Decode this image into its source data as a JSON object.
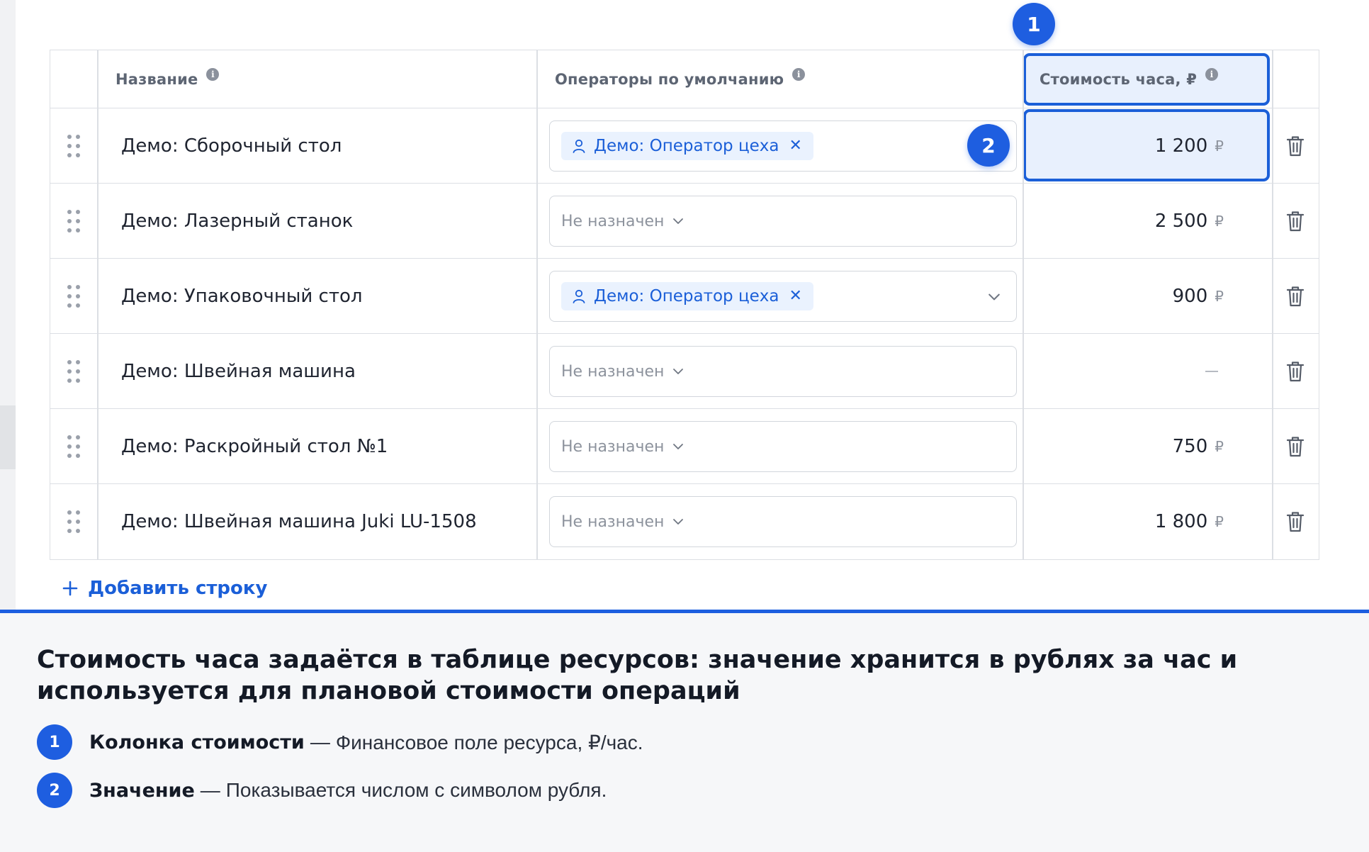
{
  "table": {
    "headers": {
      "name": "Название",
      "operators": "Операторы по умолчанию",
      "cost": "Стоимость часа, ₽"
    },
    "rows": [
      {
        "name": "Демо: Сборочный стол",
        "operator": "Демо: Оператор цеха",
        "cost": "1 200",
        "currency": "₽"
      },
      {
        "name": "Демо: Лазерный станок",
        "operator": "",
        "placeholder": "Не назначен",
        "cost": "2 500",
        "currency": "₽"
      },
      {
        "name": "Демо: Упаковочный стол",
        "operator": "Демо: Оператор цеха",
        "cost": "900",
        "currency": "₽"
      },
      {
        "name": "Демо: Швейная машина",
        "operator": "",
        "placeholder": "Не назначен",
        "cost": "",
        "currency": ""
      },
      {
        "name": "Демо: Раскройный стол №1",
        "operator": "",
        "placeholder": "Не назначен",
        "cost": "750",
        "currency": "₽"
      },
      {
        "name": "Демо: Швейная машина Juki LU-1508",
        "operator": "",
        "placeholder": "Не назначен",
        "cost": "1 800",
        "currency": "₽"
      }
    ],
    "info_glyph": "i",
    "chip_close": "✕",
    "add_row_label": "Добавить строку"
  },
  "callouts": {
    "badge_1": "1",
    "badge_2": "2"
  },
  "panel": {
    "title": "Стоимость часа задаётся в таблице ресурсов: значение хранится в рублях за час и используется для плановой стоимости операций",
    "separator": "—",
    "notes": [
      {
        "num": "1",
        "term": "Колонка стоимости",
        "desc": "Финансовое поле ресурса, ₽/час."
      },
      {
        "num": "2",
        "term": "Значение",
        "desc": "Показывается числом с символом рубля."
      }
    ]
  },
  "colors": {
    "accent": "#1e5ee0",
    "chip_bg": "#eaf2fe",
    "highlight_bg": "#e0ebfc",
    "border": "#dcdfe4",
    "panel_bg": "#f6f7f9"
  },
  "icons": [
    "drag-handle-icon",
    "info-icon",
    "user-icon",
    "close-icon",
    "chevron-down-icon",
    "trash-icon",
    "plus-icon"
  ]
}
